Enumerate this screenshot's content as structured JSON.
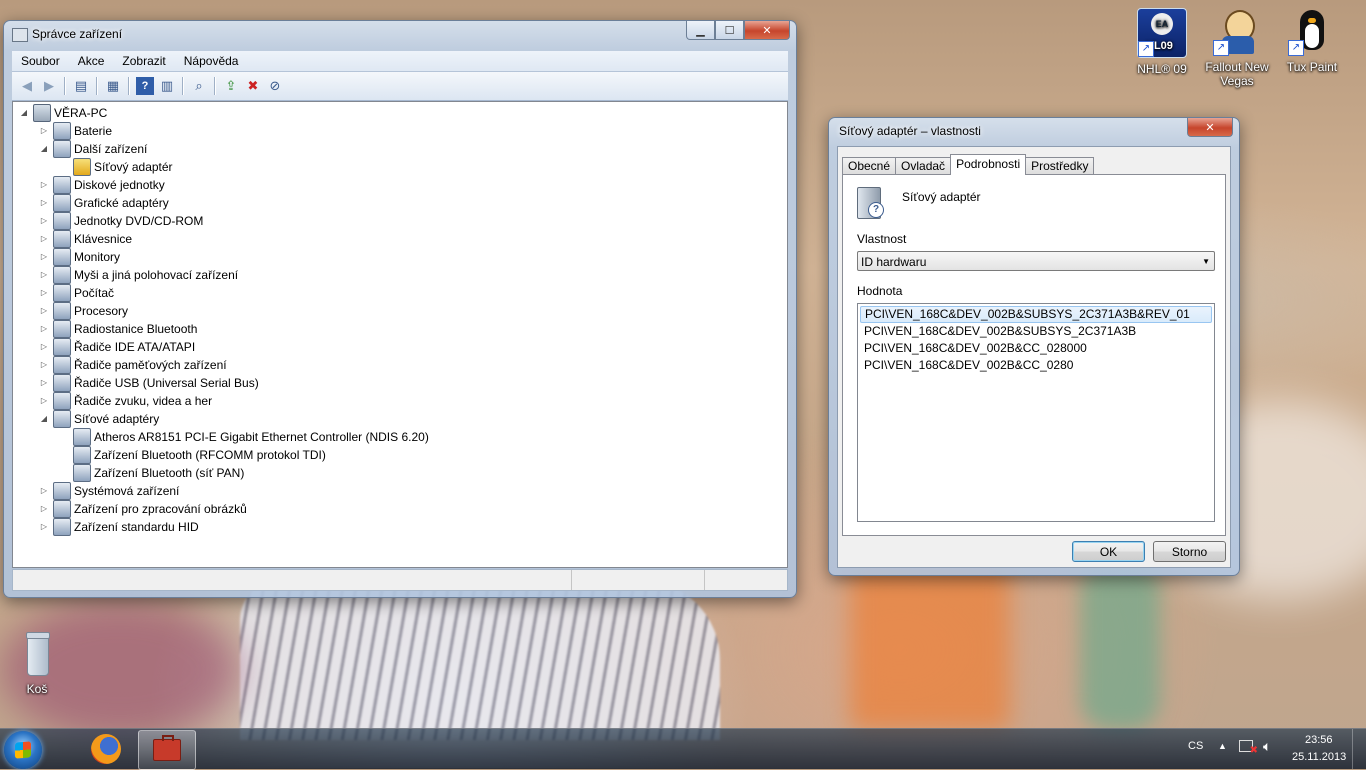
{
  "desktop": {
    "icons": [
      {
        "label": "NHL® 09",
        "icon": "nhl09-game-icon"
      },
      {
        "label": "Fallout New Vegas",
        "icon": "fallout-vaultboy-icon"
      },
      {
        "label": "Tux Paint",
        "icon": "tux-penguin-icon"
      },
      {
        "label": "Koš",
        "icon": "recycle-bin-icon"
      }
    ]
  },
  "device_manager": {
    "title": "Správce zařízení",
    "menu": [
      "Soubor",
      "Akce",
      "Zobrazit",
      "Nápověda"
    ],
    "toolbar_icons": [
      "back-arrow-icon",
      "forward-arrow-icon",
      "show-hide-console-tree-icon",
      "properties-icon",
      "help-icon",
      "action-pane-icon",
      "scan-hardware-icon",
      "update-driver-icon",
      "uninstall-icon",
      "disable-icon"
    ],
    "tree": {
      "root": "VĚRA-PC",
      "nodes": [
        {
          "label": "Baterie",
          "level": 1,
          "expanded": false
        },
        {
          "label": "Další zařízení",
          "level": 1,
          "expanded": true
        },
        {
          "label": "Síťový adaptér",
          "level": 2,
          "warning": true
        },
        {
          "label": "Diskové jednotky",
          "level": 1,
          "expanded": false
        },
        {
          "label": "Grafické adaptéry",
          "level": 1,
          "expanded": false
        },
        {
          "label": "Jednotky DVD/CD-ROM",
          "level": 1,
          "expanded": false
        },
        {
          "label": "Klávesnice",
          "level": 1,
          "expanded": false
        },
        {
          "label": "Monitory",
          "level": 1,
          "expanded": false
        },
        {
          "label": "Myši a jiná polohovací zařízení",
          "level": 1,
          "expanded": false
        },
        {
          "label": "Počítač",
          "level": 1,
          "expanded": false
        },
        {
          "label": "Procesory",
          "level": 1,
          "expanded": false
        },
        {
          "label": "Radiostanice Bluetooth",
          "level": 1,
          "expanded": false
        },
        {
          "label": "Řadiče IDE ATA/ATAPI",
          "level": 1,
          "expanded": false
        },
        {
          "label": "Řadiče paměťových zařízení",
          "level": 1,
          "expanded": false
        },
        {
          "label": "Řadiče USB (Universal Serial Bus)",
          "level": 1,
          "expanded": false
        },
        {
          "label": "Řadiče zvuku, videa a her",
          "level": 1,
          "expanded": false
        },
        {
          "label": "Síťové adaptéry",
          "level": 1,
          "expanded": true
        },
        {
          "label": "Atheros AR8151 PCI-E Gigabit Ethernet Controller (NDIS 6.20)",
          "level": 2
        },
        {
          "label": "Zařízení Bluetooth (RFCOMM protokol TDI)",
          "level": 2
        },
        {
          "label": "Zařízení Bluetooth (síť PAN)",
          "level": 2
        },
        {
          "label": "Systémová zařízení",
          "level": 1,
          "expanded": false
        },
        {
          "label": "Zařízení pro zpracování obrázků",
          "level": 1,
          "expanded": false
        },
        {
          "label": "Zařízení standardu HID",
          "level": 1,
          "expanded": false
        }
      ]
    }
  },
  "properties_dialog": {
    "title": "Síťový adaptér – vlastnosti",
    "tabs": [
      "Obecné",
      "Ovladač",
      "Podrobnosti",
      "Prostředky"
    ],
    "active_tab": "Podrobnosti",
    "device_name": "Síťový adaptér",
    "property_label": "Vlastnost",
    "property_selected": "ID hardwaru",
    "value_label": "Hodnota",
    "values": [
      "PCI\\VEN_168C&DEV_002B&SUBSYS_2C371A3B&REV_01",
      "PCI\\VEN_168C&DEV_002B&SUBSYS_2C371A3B",
      "PCI\\VEN_168C&DEV_002B&CC_028000",
      "PCI\\VEN_168C&DEV_002B&CC_0280"
    ],
    "ok_label": "OK",
    "cancel_label": "Storno"
  },
  "taskbar": {
    "language": "CS",
    "time": "23:56",
    "date": "25.11.2013",
    "pinned": [
      "firefox-icon",
      "device-manager-toolbox-icon"
    ]
  },
  "colors": {
    "selection": "#d9ebfb",
    "window_frame": "#bcd0e8",
    "close_red": "#c6452c"
  }
}
